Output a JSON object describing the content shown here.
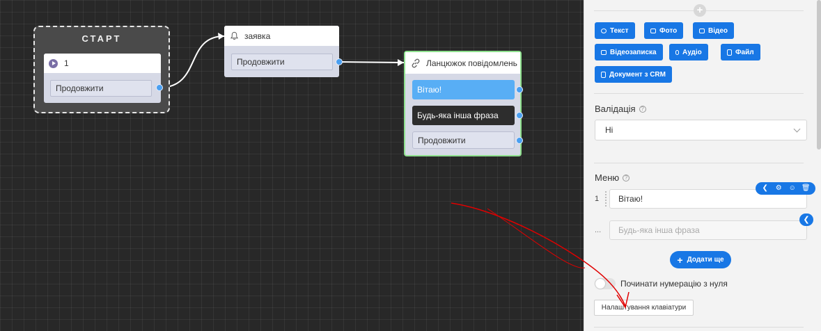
{
  "canvas": {
    "start_node": {
      "title": "СТАРТ",
      "label": "1",
      "button": "Продовжити"
    },
    "request_node": {
      "title": "заявка",
      "button": "Продовжити"
    },
    "chain_node": {
      "title": "Ланцюжок повідомлень",
      "buttons": [
        "Вітаю!",
        "Будь-яка інша фраза",
        "Продовжити"
      ]
    }
  },
  "panel": {
    "media_buttons": [
      "Текст",
      "Фото",
      "Відео",
      "Відеозаписка",
      "Аудіо",
      "Файл",
      "Документ з CRM"
    ],
    "validation": {
      "label": "Валідація",
      "value": "Ні"
    },
    "menu": {
      "label": "Меню",
      "items": [
        {
          "number": "1",
          "value": "Вітаю!"
        },
        {
          "number": "...",
          "placeholder": "Будь-яка інша фраза"
        }
      ],
      "add_more": "Додати ще",
      "numbering_toggle": "Починати нумерацію з нуля",
      "keyboard_settings": "Налаштування клавіатури"
    }
  },
  "colors": {
    "accent": "#1877e5",
    "port": "#4a9ff0",
    "active_border": "#8ee08e",
    "annotation": "#e00000"
  }
}
